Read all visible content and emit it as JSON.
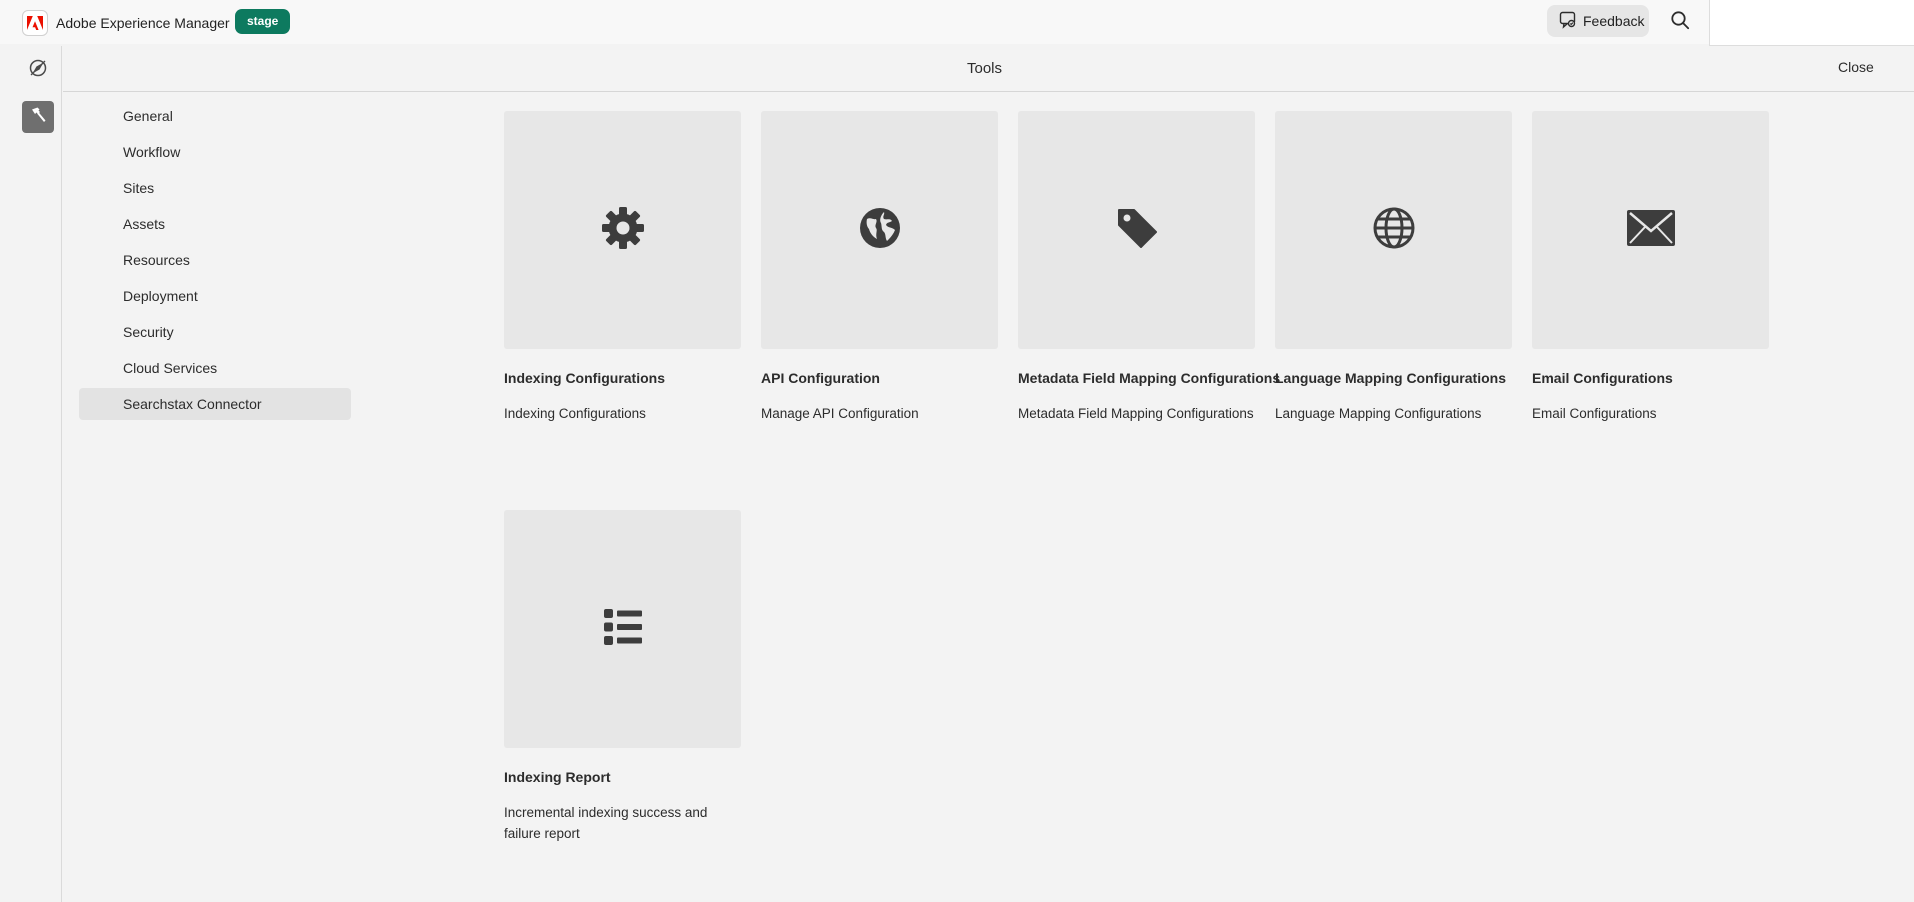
{
  "topbar": {
    "app_name": "Adobe Experience Manager",
    "env_badge": "stage",
    "feedback_label": "Feedback",
    "logo_icon": "adobe-logo-icon",
    "brand_color": "#eb1000",
    "env_color": "#0d7a5f"
  },
  "panel": {
    "title": "Tools",
    "close_label": "Close"
  },
  "rail": {
    "items": [
      {
        "icon": "navigation-compass-icon",
        "active": false
      },
      {
        "icon": "hammer-icon",
        "active": true
      }
    ]
  },
  "categories": [
    {
      "label": "General",
      "selected": false
    },
    {
      "label": "Workflow",
      "selected": false
    },
    {
      "label": "Sites",
      "selected": false
    },
    {
      "label": "Assets",
      "selected": false
    },
    {
      "label": "Resources",
      "selected": false
    },
    {
      "label": "Deployment",
      "selected": false
    },
    {
      "label": "Security",
      "selected": false
    },
    {
      "label": "Cloud Services",
      "selected": false
    },
    {
      "label": "Searchstax Connector",
      "selected": true
    }
  ],
  "cards": [
    {
      "title": "Indexing Configurations",
      "description": "Indexing Configurations",
      "icon": "gear-icon"
    },
    {
      "title": "API Configuration",
      "description": "Manage API Configuration",
      "icon": "earth-icon"
    },
    {
      "title": "Metadata Field Mapping Configurations",
      "description": "Metadata Field Mapping Configurations",
      "icon": "tag-icon"
    },
    {
      "title": "Language Mapping Configurations",
      "description": "Language Mapping Configurations",
      "icon": "globe-grid-icon"
    },
    {
      "title": "Email Configurations",
      "description": "Email Configurations",
      "icon": "envelope-icon"
    },
    {
      "title": "Indexing Report",
      "description": "Incremental indexing success and failure report",
      "icon": "list-icon"
    }
  ]
}
